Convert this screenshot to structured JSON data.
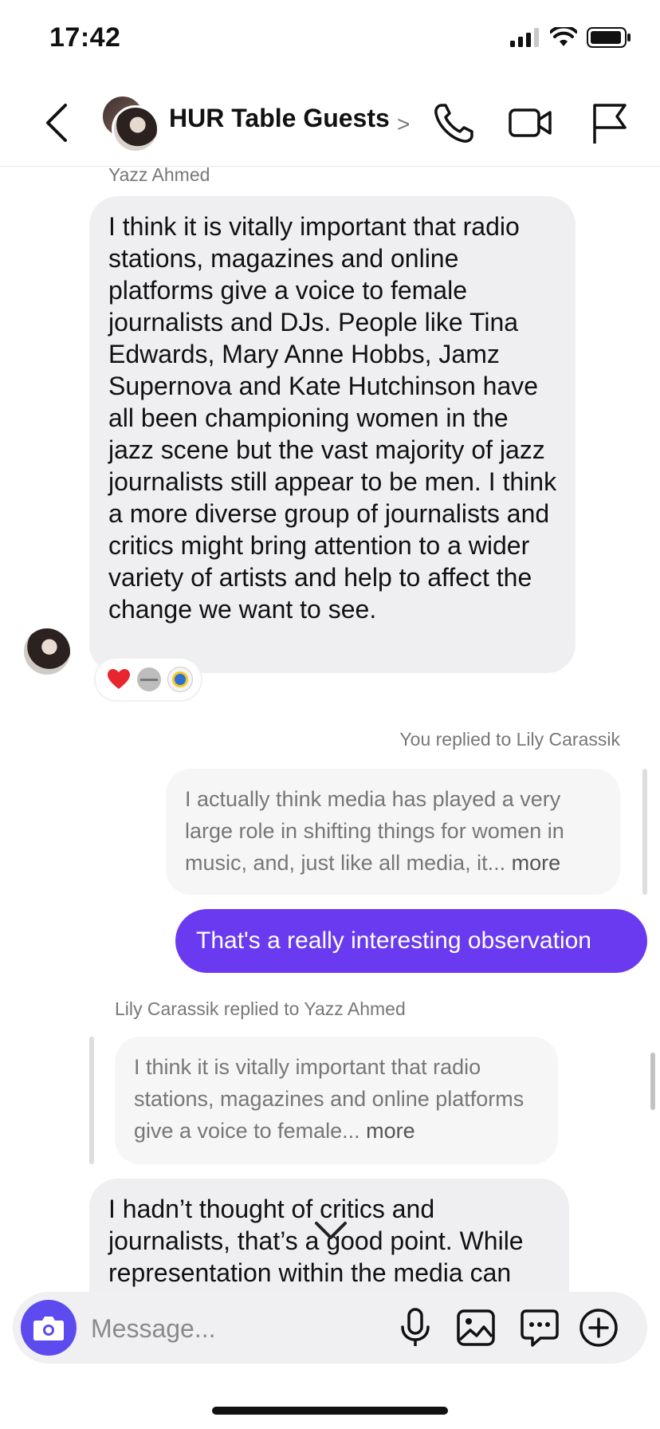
{
  "status_bar": {
    "time": "17:42"
  },
  "header": {
    "title": "HUR Table Guests",
    "chevron": ">"
  },
  "messages": {
    "msg1": {
      "sender": "Yazz Ahmed",
      "text": "I think it is vitally important that radio stations, magazines and online platforms give a voice to female journalists and DJs. People like Tina Edwards, Mary Anne Hobbs, Jamz Supernova and Kate Hutchinson have all been championing women in the jazz scene but the vast majority of jazz journalists still appear to be men. I think a more diverse group of journalists and critics might bring attention to a wider variety of artists and help to affect the change we want to see.",
      "reactions": [
        "heart",
        "gray-disc",
        "logo-badge"
      ]
    },
    "msg2": {
      "reply_context": "You replied to Lily Carassik",
      "quoted_text": "I actually think media has played a very large role in shifting things for women in music, and, just like all media, it...",
      "more_label": "more",
      "text": "That's a really interesting observation"
    },
    "msg3": {
      "reply_context": "Lily Carassik replied to Yazz Ahmed",
      "quoted_text": "I think it is vitally important that radio stations, magazines and online platforms give a voice to female...",
      "more_label": "more",
      "text": "I hadn’t thought of critics and journalists, that’s a good point. While representation within the media can"
    }
  },
  "composer": {
    "placeholder": "Message..."
  },
  "colors": {
    "accent": "#6a3af1",
    "camera": "#5d4bf0",
    "incoming_bubble": "#efeff1",
    "quote_bubble": "#f6f6f7"
  },
  "icons": [
    "back-chevron-icon",
    "phone-icon",
    "video-icon",
    "flag-icon",
    "camera-icon",
    "microphone-icon",
    "gallery-icon",
    "chat-bubble-icon",
    "plus-icon",
    "chevron-down-icon"
  ]
}
